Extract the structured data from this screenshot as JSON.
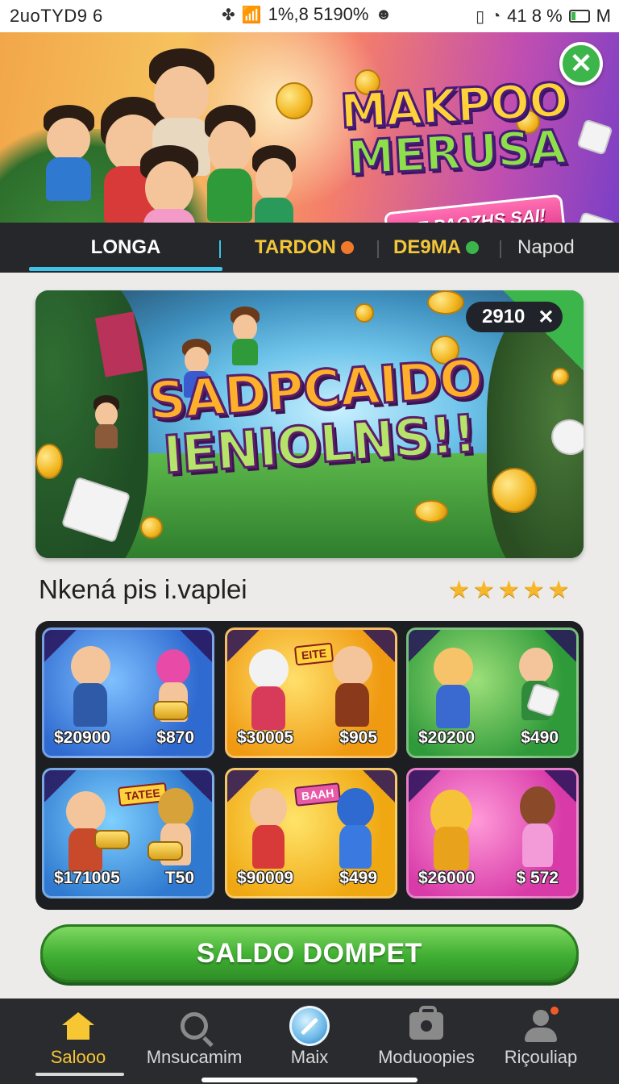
{
  "status_bar": {
    "left_text": "2uoTYD9 6",
    "middle_text": "1%,8 5190%",
    "right_text": "41 8 %",
    "right_letter": "M",
    "battery_level_percent": 35
  },
  "banner": {
    "title_line1": "MAKPOO",
    "title_line2": "MERUSA",
    "ribbon_text": "BE PAOZHS SAI!"
  },
  "tabs": [
    {
      "label": "LONGA",
      "active": true
    },
    {
      "label": "TARDON",
      "dot_color": "#f07a2a"
    },
    {
      "label": "DE9MA",
      "dot_color": "#3cb54a"
    },
    {
      "label": "Napod"
    }
  ],
  "hero": {
    "title_line1": "SADPCAIDO",
    "title_line2": "IENIOLNS!!",
    "badge_value": "2910"
  },
  "section": {
    "title": "Nkená pis i.vaplei",
    "rating_stars": 5
  },
  "products": [
    {
      "price_left": "$20900",
      "price_right": "$870"
    },
    {
      "price_left": "$30005",
      "price_right": "$905",
      "tag": "EITE"
    },
    {
      "price_left": "$20200",
      "price_right": "$490"
    },
    {
      "price_left": "$171005",
      "price_right": "T50",
      "tag": "TATEE"
    },
    {
      "price_left": "$90009",
      "price_right": "$499",
      "tag": "BAAH"
    },
    {
      "price_left": "$26000",
      "price_right": "$ 572"
    }
  ],
  "cta": {
    "label": "SALDO DOMPET"
  },
  "bottom_nav": [
    {
      "label": "Salooo",
      "icon": "home-icon",
      "active": true
    },
    {
      "label": "Mnsucamim",
      "icon": "search-icon"
    },
    {
      "label": "Maix",
      "icon": "center-action-icon"
    },
    {
      "label": "Moduoopies",
      "icon": "bag-icon"
    },
    {
      "label": "Riçouliap",
      "icon": "user-icon"
    }
  ],
  "colors": {
    "accent_tab": "#3ec4e8",
    "active_nav": "#f6c633",
    "cta_green": "#3fae32",
    "tab_gold": "#f3c63a"
  }
}
